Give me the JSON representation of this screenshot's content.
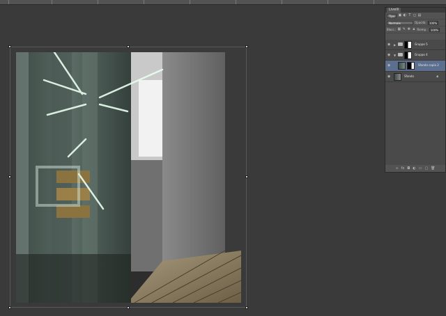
{
  "panel": {
    "tab_label": "Livelli",
    "filter_label": "Tipo",
    "blend_mode": "Normale",
    "opacity_label": "Opacità:",
    "opacity_value": "100%",
    "lock_label": "Blocc.:",
    "fill_label": "Riemp.:",
    "fill_value": "100%",
    "layers": [
      {
        "name": "Gruppo 5",
        "type": "group",
        "collapsed": true
      },
      {
        "name": "Gruppo 4",
        "type": "group",
        "collapsed": false
      },
      {
        "name": "Sfondo copia 2",
        "type": "masked",
        "selected": true
      },
      {
        "name": "Sfondo",
        "type": "background",
        "locked": true
      }
    ]
  },
  "colors": {
    "selection": "#5c6f8f",
    "panel_bg": "#535353",
    "workspace_bg": "#3a3a3a"
  },
  "icons": {
    "visibility": "eye-icon",
    "group": "folder-icon",
    "lock": "lock-icon"
  }
}
